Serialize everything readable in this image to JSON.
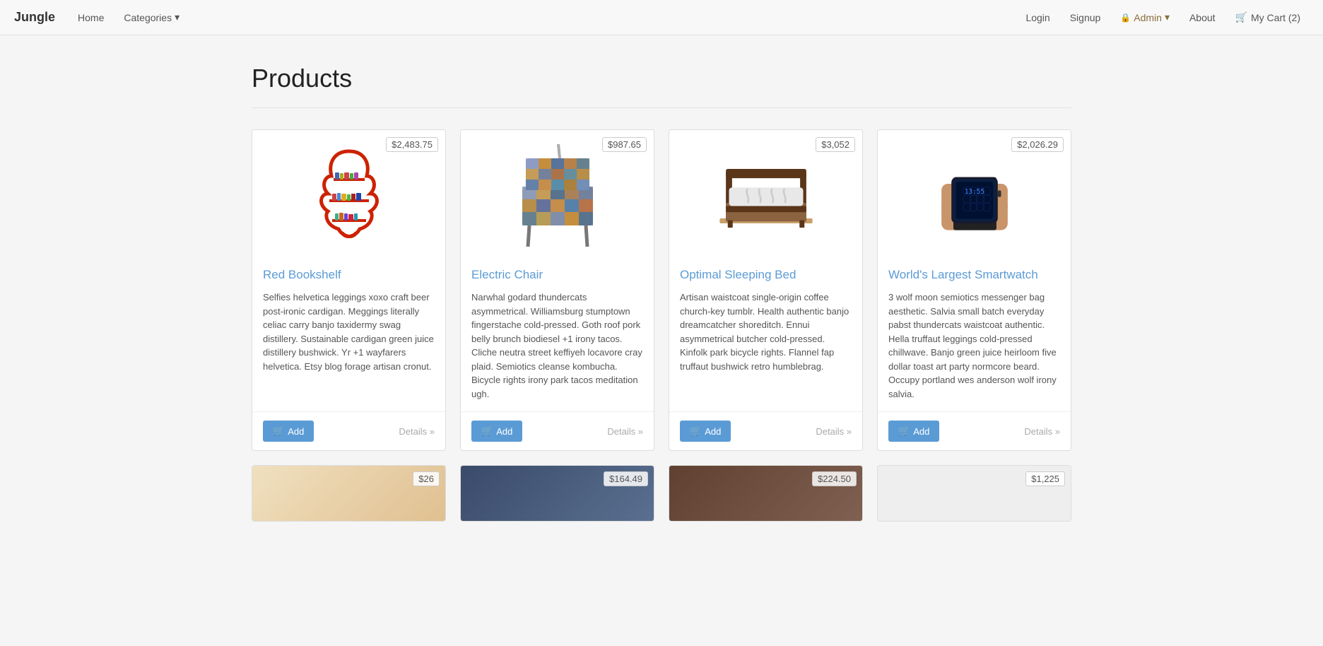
{
  "brand": "Jungle",
  "nav": {
    "home": "Home",
    "categories": "Categories",
    "login": "Login",
    "signup": "Signup",
    "admin": "Admin",
    "about": "About",
    "cart": "My Cart (2)"
  },
  "page": {
    "title": "Products"
  },
  "products": [
    {
      "id": 1,
      "name": "Red Bookshelf",
      "price": "$2,483.75",
      "description": "Selfies helvetica leggings xoxo craft beer post-ironic cardigan. Meggings literally celiac carry banjo taxidermy swag distillery. Sustainable cardigan green juice distillery bushwick. Yr +1 wayfarers helvetica. Etsy blog forage artisan cronut.",
      "color": "red-bookshelf"
    },
    {
      "id": 2,
      "name": "Electric Chair",
      "price": "$987.65",
      "description": "Narwhal godard thundercats asymmetrical. Williamsburg stumptown fingerstache cold-pressed. Goth roof pork belly brunch biodiesel +1 irony tacos. Cliche neutra street keffiyeh locavore cray plaid. Semiotics cleanse kombucha. Bicycle rights irony park tacos meditation ugh.",
      "color": "electric-chair"
    },
    {
      "id": 3,
      "name": "Optimal Sleeping Bed",
      "price": "$3,052",
      "description": "Artisan waistcoat single-origin coffee church-key tumblr. Health authentic banjo dreamcatcher shoreditch. Ennui asymmetrical butcher cold-pressed. Kinfolk park bicycle rights. Flannel fap truffaut bushwick retro humblebrag.",
      "color": "sleeping-bed"
    },
    {
      "id": 4,
      "name": "World's Largest Smartwatch",
      "price": "$2,026.29",
      "description": "3 wolf moon semiotics messenger bag aesthetic. Salvia small batch everyday pabst thundercats waistcoat authentic. Hella truffaut leggings cold-pressed chillwave. Banjo green juice heirloom five dollar toast art party normcore beard. Occupy portland wes anderson wolf irony salvia.",
      "color": "smartwatch"
    }
  ],
  "bottom_products": [
    {
      "id": 5,
      "price": "$26"
    },
    {
      "id": 6,
      "price": "$164.49"
    },
    {
      "id": 7,
      "price": "$224.50"
    },
    {
      "id": 8,
      "price": "$1,225"
    }
  ],
  "buttons": {
    "add": "Add",
    "details": "Details »"
  }
}
